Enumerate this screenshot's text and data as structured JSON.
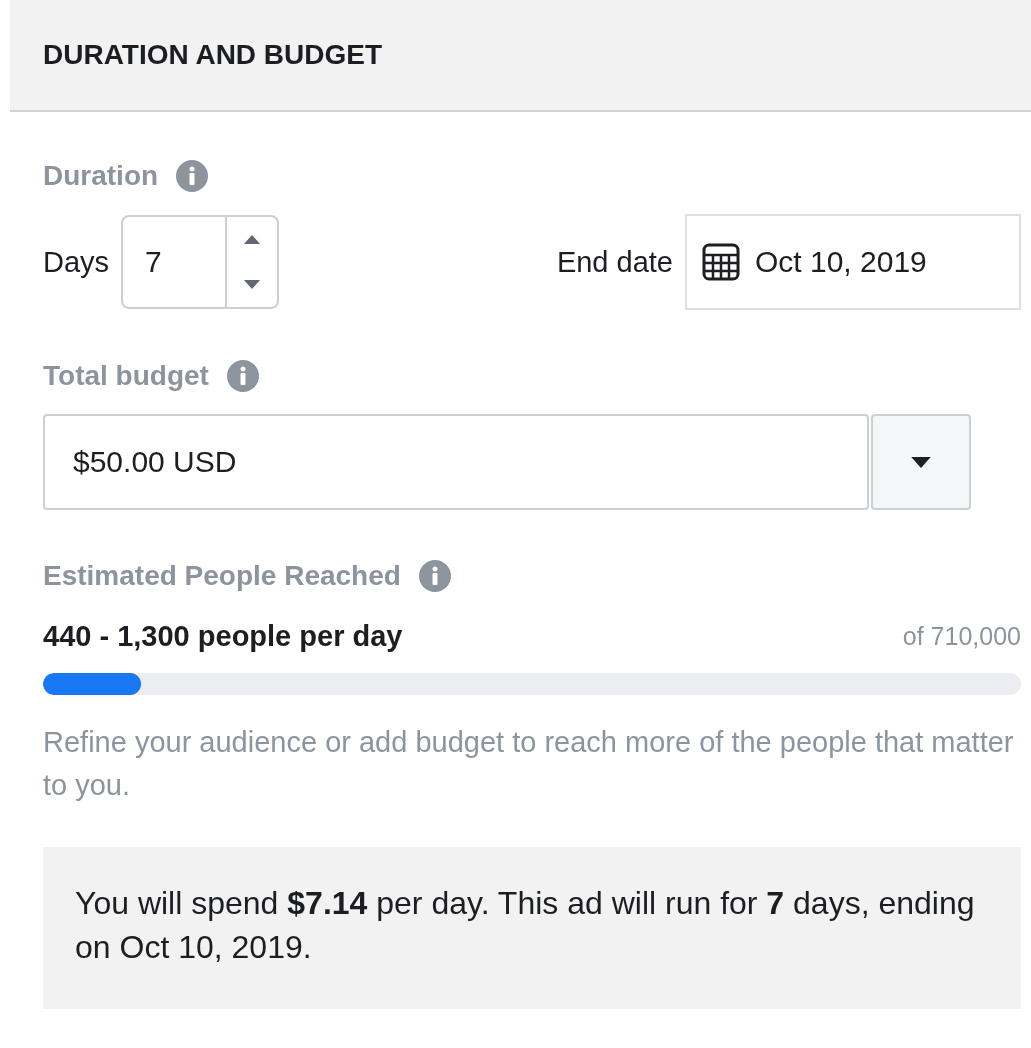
{
  "section": {
    "title": "DURATION AND BUDGET"
  },
  "duration": {
    "label": "Duration",
    "days_label": "Days",
    "days_value": "7",
    "end_date_label": "End date",
    "end_date_value": "Oct 10, 2019"
  },
  "budget": {
    "label": "Total budget",
    "value": "$50.00 USD"
  },
  "reach": {
    "label": "Estimated People Reached",
    "range": "440 - 1,300 people per day",
    "total": "of 710,000",
    "level": 0.1,
    "hint": "Refine your audience or add budget to reach more of the people that matter to you."
  },
  "summary": "You will spend **$7.14** per day. This ad will run for **7** days, ending on Oct 10, 2019."
}
